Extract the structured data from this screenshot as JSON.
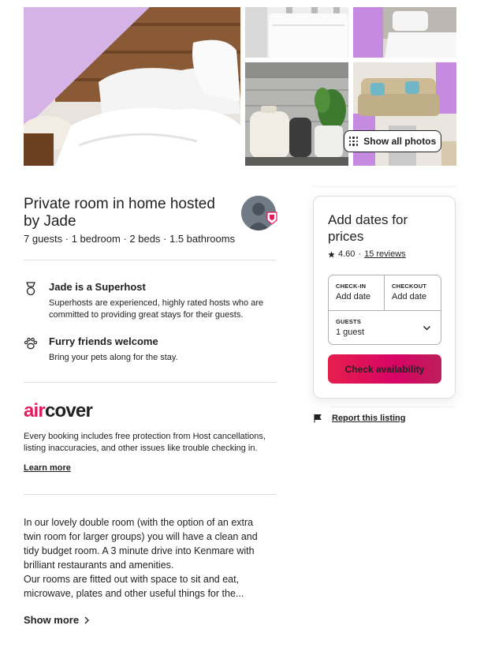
{
  "colors": {
    "brand": "#e31c5f",
    "button_gradient_start": "#e61e4d",
    "button_gradient_end": "#bd1e59",
    "text": "#222222",
    "divider": "#dddddd"
  },
  "gallery": {
    "show_all_label": "Show all photos",
    "photos": [
      "bedroom-bed",
      "bathroom-sink",
      "twin-room-bed",
      "kitchen-kettle",
      "living-room-sofa"
    ]
  },
  "listing": {
    "title": "Private room in home hosted by Jade",
    "summary": "7 guests · 1 bedroom · 2 beds · 1.5 bathrooms"
  },
  "highlights": [
    {
      "icon": "superhost-medal-icon",
      "title": "Jade is a Superhost",
      "description": "Superhosts are experienced, highly rated hosts who are committed to providing great stays for their guests."
    },
    {
      "icon": "paw-icon",
      "title": "Furry friends welcome",
      "description": "Bring your pets along for the stay."
    }
  ],
  "aircover": {
    "logo_air": "air",
    "logo_cover": "cover",
    "text": "Every booking includes free protection from Host cancellations, listing inaccuracies, and other issues like trouble checking in.",
    "learn_more": "Learn more"
  },
  "description": {
    "lines": [
      "In our lovely double room (with the option of an extra",
      "twin room for larger groups) you will have a clean and",
      "tidy budget room. A 3 minute drive into Kenmare with",
      "brilliant restaurants and amenities.",
      "Our rooms are fitted out with space to sit and eat,",
      "microwave, plates and other useful things for the..."
    ],
    "show_more": "Show more"
  },
  "booking": {
    "title": "Add dates for prices",
    "rating": "4.60",
    "separator": "·",
    "reviews": "15 reviews",
    "checkin_label": "CHECK-IN",
    "checkin_value": "Add date",
    "checkout_label": "CHECKOUT",
    "checkout_value": "Add date",
    "guests_label": "GUESTS",
    "guests_value": "1 guest",
    "button": "Check availability"
  },
  "report": {
    "label": "Report this listing"
  }
}
